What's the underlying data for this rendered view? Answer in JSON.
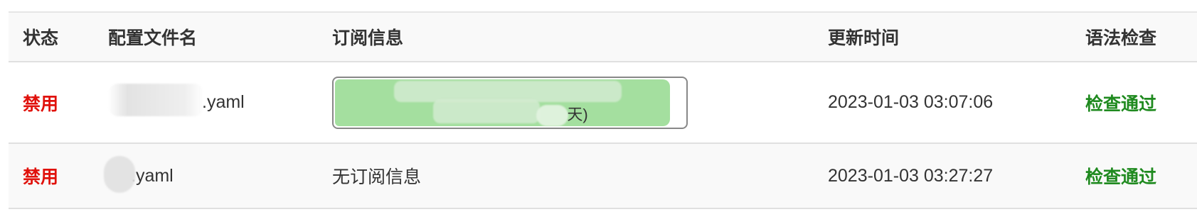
{
  "table": {
    "headers": {
      "status": "状态",
      "filename": "配置文件名",
      "subscription": "订阅信息",
      "updated": "更新时间",
      "syntax": "语法检查"
    },
    "rows": [
      {
        "status": "禁用",
        "filename": ".yaml",
        "subscription": {
          "text": "天)",
          "progress_fraction": 0.95
        },
        "updated": "2023-01-03 03:07:06",
        "syntax": "检查通过"
      },
      {
        "status": "禁用",
        "filename": ".yaml",
        "subscription": {
          "text": "无订阅信息"
        },
        "updated": "2023-01-03 03:27:27",
        "syntax": "检查通过"
      }
    ]
  },
  "colors": {
    "status_disabled": "#e0120c",
    "syntax_pass": "#1f8a1f",
    "progress_fill": "#a4df9f",
    "header_bg": "#f9f9f9",
    "border": "#e0e0e0"
  }
}
